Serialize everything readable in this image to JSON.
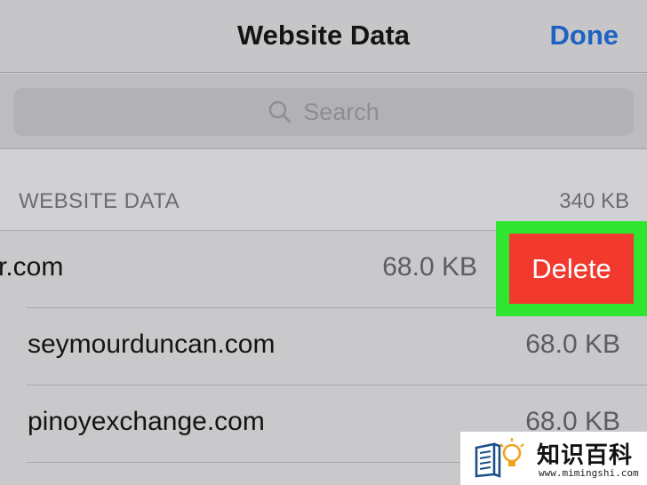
{
  "navbar": {
    "title": "Website Data",
    "done_label": "Done"
  },
  "search": {
    "placeholder": "Search",
    "icon": "search-icon"
  },
  "section": {
    "title": "WEBSITE DATA",
    "total": "340 KB"
  },
  "rows": [
    {
      "label": "r.com",
      "size": "68.0 KB"
    },
    {
      "label": "seymourduncan.com",
      "size": "68.0 KB"
    },
    {
      "label": "pinoyexchange.com",
      "size": "68.0 KB"
    }
  ],
  "swipe": {
    "delete_label": "Delete"
  },
  "watermark": {
    "title": "知识百科",
    "url": "www.mimingshi.com"
  },
  "colors": {
    "accent": "#1f62c2",
    "delete": "#f2392e",
    "highlight": "#2fe52f"
  }
}
